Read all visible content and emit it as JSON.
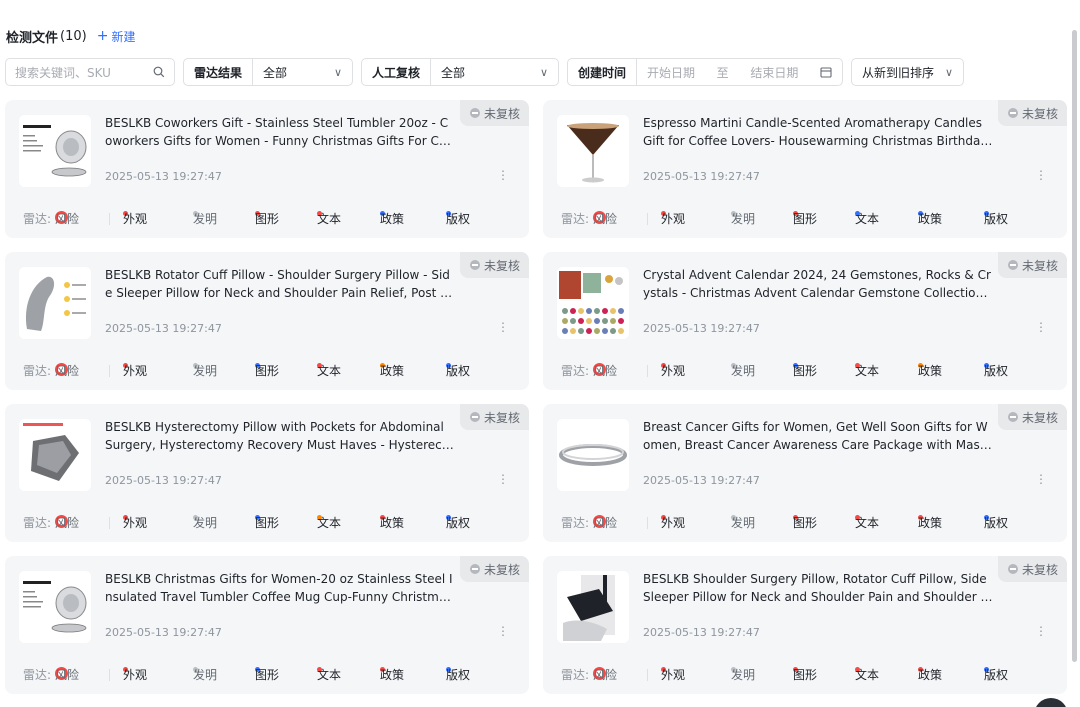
{
  "header": {
    "title": "检测文件",
    "count": "(10)",
    "new_label": "新建"
  },
  "filters": {
    "search_placeholder": "搜索关键词、SKU",
    "radar_label": "雷达结果",
    "radar_value": "全部",
    "review_label": "人工复核",
    "review_value": "全部",
    "date_label": "创建时间",
    "date_start_placeholder": "开始日期",
    "date_sep": "至",
    "date_end_placeholder": "结束日期",
    "sort_value": "从新到旧排序"
  },
  "radar_prefix": "雷达:",
  "risk_label": "风险",
  "badge_label": "未复核",
  "tag_labels": [
    "外观",
    "发明",
    "图形",
    "文本",
    "政策",
    "版权"
  ],
  "colors": {
    "red": "#f54a45",
    "blue": "#3370ff",
    "orange": "#ff8800",
    "gray": "#bbbfc4"
  },
  "cards": [
    {
      "title": "BESLKB Coworkers Gift - Stainless Steel Tumbler 20oz - Coworkers Gifts for Women - Funny Christmas Gifts For Coworkers",
      "time": "2025-05-13 19:27:47",
      "thumb": "tumbler",
      "tags": [
        "red",
        "gray",
        "red",
        "red",
        "blue",
        "blue"
      ]
    },
    {
      "title": "Espresso Martini Candle-Scented Aromatherapy Candles Gift for Coffee Lovers- Housewarming Christmas Birthday Gift Candles",
      "time": "2025-05-13 19:27:47",
      "thumb": "martini",
      "tags": [
        "red",
        "gray",
        "red",
        "blue",
        "blue",
        "blue"
      ]
    },
    {
      "title": "BESLKB Rotator Cuff Pillow - Shoulder Surgery Pillow - Side Sleeper Pillow for Neck and Shoulder Pain Relief, Post Shoulder Surgery",
      "time": "2025-05-13 19:27:47",
      "thumb": "pillow",
      "tags": [
        "red",
        "gray",
        "blue",
        "red",
        "orange",
        "blue"
      ]
    },
    {
      "title": "Crystal Advent Calendar 2024, 24 Gemstones, Rocks & Crystals - Christmas Advent Calendar Gemstone Collection with Gemstone Cards",
      "time": "2025-05-13 19:27:47",
      "thumb": "crystals",
      "tags": [
        "red",
        "gray",
        "blue",
        "red",
        "orange",
        "blue"
      ]
    },
    {
      "title": "BESLKB Hysterectomy Pillow with Pockets for Abdominal Surgery, Hysterectomy Recovery Must Haves - Hysterectomy Recovery Pillow",
      "time": "2025-05-13 19:27:47",
      "thumb": "hyster",
      "tags": [
        "red",
        "gray",
        "blue",
        "orange",
        "red",
        "blue"
      ]
    },
    {
      "title": "Breast Cancer Gifts for Women, Get Well Soon Gifts for Women, Breast Cancer Awareness Care Package with Mastectomy Bracelet",
      "time": "2025-05-13 19:27:47",
      "thumb": "bracelet",
      "tags": [
        "red",
        "gray",
        "red",
        "red",
        "red",
        "blue"
      ]
    },
    {
      "title": "BESLKB Christmas Gifts for Women-20 oz Stainless Steel Insulated Travel Tumbler Coffee Mug Cup-Funny Christmas Gifts for Coworkers",
      "time": "2025-05-13 19:27:47",
      "thumb": "tumbler",
      "tags": [
        "red",
        "gray",
        "blue",
        "red",
        "red",
        "blue"
      ]
    },
    {
      "title": "BESLKB Shoulder Surgery Pillow, Rotator Cuff Pillow, Side Sleeper Pillow for Neck and Shoulder Pain and Shoulder Relief",
      "time": "2025-05-13 19:27:47",
      "thumb": "sling",
      "tags": [
        "red",
        "gray",
        "red",
        "red",
        "red",
        "blue"
      ]
    }
  ]
}
